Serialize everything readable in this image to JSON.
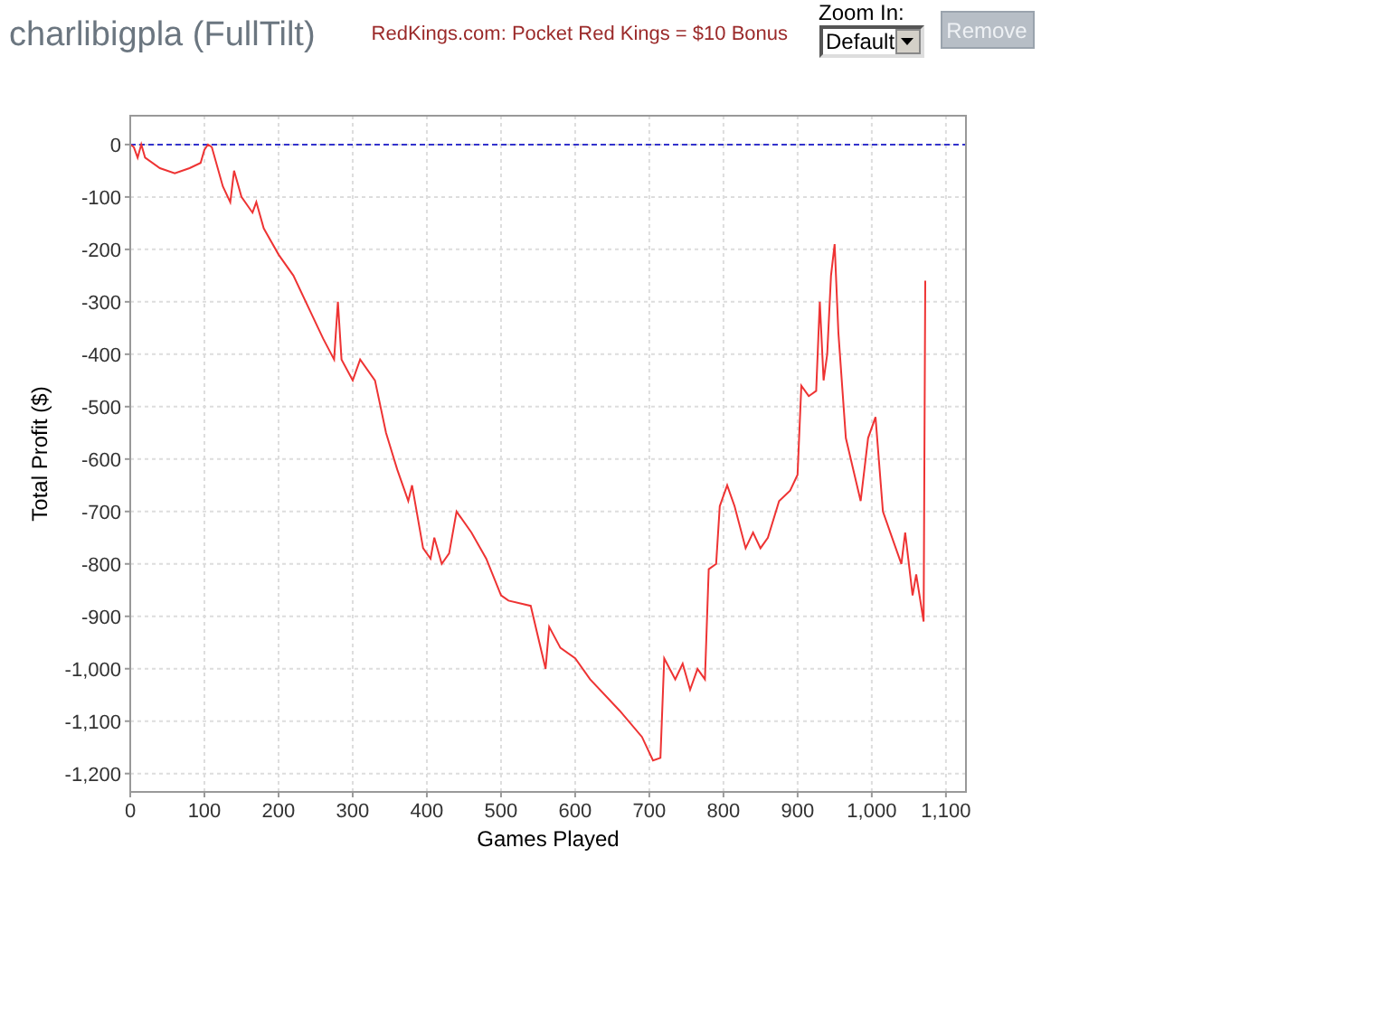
{
  "header": {
    "title": "charlibigpla (FullTilt)",
    "promo_link": "RedKings.com: Pocket Red Kings = $10 Bonus",
    "zoom": {
      "label": "Zoom In:",
      "value": "Default"
    },
    "remove_button": {
      "label": "Remove",
      "disabled": true
    }
  },
  "chart": {
    "chart_data": {
      "type": "line",
      "xlabel": "Games Played",
      "ylabel": "Total Profit ($)",
      "xlim": [
        0,
        1127
      ],
      "ylim": [
        -1235,
        55
      ],
      "xticks": [
        0,
        100,
        200,
        300,
        400,
        500,
        600,
        700,
        800,
        900,
        {
          "value": 1000,
          "label": "1,000"
        },
        {
          "value": 1100,
          "label": "1,100"
        }
      ],
      "yticks": [
        0,
        -100,
        -200,
        -300,
        -400,
        -500,
        -600,
        -700,
        -800,
        -900,
        {
          "value": -1000,
          "label": "-1,000"
        },
        {
          "value": -1100,
          "label": "-1,100"
        },
        {
          "value": -1200,
          "label": "-1,200"
        }
      ],
      "x": [
        0,
        5,
        10,
        15,
        20,
        40,
        60,
        80,
        95,
        100,
        105,
        110,
        125,
        135,
        140,
        150,
        165,
        170,
        180,
        200,
        220,
        240,
        260,
        275,
        280,
        285,
        300,
        310,
        330,
        345,
        360,
        375,
        380,
        395,
        405,
        410,
        420,
        430,
        440,
        460,
        480,
        500,
        510,
        540,
        560,
        565,
        580,
        600,
        620,
        660,
        690,
        705,
        715,
        720,
        735,
        745,
        755,
        765,
        775,
        780,
        790,
        795,
        805,
        815,
        830,
        840,
        850,
        860,
        875,
        890,
        900,
        905,
        915,
        925,
        930,
        935,
        940,
        945,
        950,
        955,
        965,
        975,
        985,
        995,
        1005,
        1015,
        1030,
        1040,
        1045,
        1055,
        1060,
        1070,
        1072
      ],
      "series": [
        {
          "color": "#ee3333",
          "values": [
            0,
            -5,
            -25,
            0,
            -25,
            -45,
            -55,
            -45,
            -35,
            -10,
            0,
            -5,
            -80,
            -110,
            -50,
            -100,
            -130,
            -110,
            -160,
            -210,
            -250,
            -310,
            -370,
            -410,
            -300,
            -410,
            -450,
            -410,
            -450,
            -550,
            -620,
            -680,
            -650,
            -770,
            -790,
            -750,
            -800,
            -780,
            -700,
            -740,
            -790,
            -860,
            -870,
            -880,
            -1000,
            -920,
            -960,
            -980,
            -1020,
            -1080,
            -1130,
            -1175,
            -1170,
            -980,
            -1020,
            -990,
            -1040,
            -1000,
            -1020,
            -810,
            -800,
            -690,
            -650,
            -690,
            -770,
            -740,
            -770,
            -750,
            -680,
            -660,
            -630,
            -460,
            -480,
            -470,
            -300,
            -450,
            -400,
            -250,
            -190,
            -360,
            -560,
            -620,
            -680,
            -560,
            -520,
            -700,
            -760,
            -800,
            -740,
            -860,
            -820,
            -910,
            -260
          ]
        }
      ],
      "grid": true,
      "ref_lines": [
        {
          "axis": "y",
          "value": 0,
          "color": "#3333cc"
        }
      ]
    }
  }
}
